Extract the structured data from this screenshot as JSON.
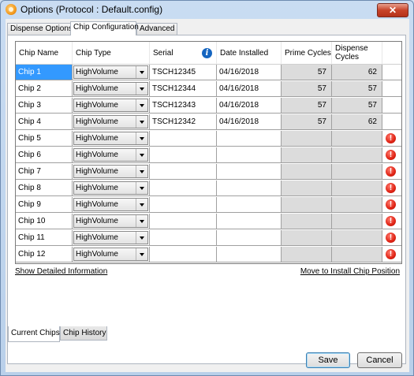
{
  "window": {
    "title": "Options (Protocol : Default.config)",
    "close_glyph": "✕",
    "app_icon": "options-app-icon"
  },
  "tabs": [
    {
      "label": "Dispense Options",
      "active": false
    },
    {
      "label": "Chip Configuration",
      "active": true
    },
    {
      "label": "Advanced",
      "active": false
    }
  ],
  "grid": {
    "headers": {
      "chip_name": "Chip Name",
      "chip_type": "Chip Type",
      "serial": "Serial",
      "date_installed": "Date Installed",
      "prime_cycles": "Prime Cycles",
      "dispense_cycles": "Dispense Cycles"
    },
    "rows": [
      {
        "name": "Chip 1",
        "type": "HighVolume",
        "serial": "TSCH12345",
        "date": "04/16/2018",
        "prime": "57",
        "dispense": "62",
        "warning": false,
        "selected": true
      },
      {
        "name": "Chip 2",
        "type": "HighVolume",
        "serial": "TSCH12344",
        "date": "04/16/2018",
        "prime": "57",
        "dispense": "57",
        "warning": false,
        "selected": false
      },
      {
        "name": "Chip 3",
        "type": "HighVolume",
        "serial": "TSCH12343",
        "date": "04/16/2018",
        "prime": "57",
        "dispense": "57",
        "warning": false,
        "selected": false
      },
      {
        "name": "Chip 4",
        "type": "HighVolume",
        "serial": "TSCH12342",
        "date": "04/16/2018",
        "prime": "57",
        "dispense": "62",
        "warning": false,
        "selected": false
      },
      {
        "name": "Chip 5",
        "type": "HighVolume",
        "serial": "",
        "date": "",
        "prime": "",
        "dispense": "",
        "warning": true,
        "selected": false
      },
      {
        "name": "Chip 6",
        "type": "HighVolume",
        "serial": "",
        "date": "",
        "prime": "",
        "dispense": "",
        "warning": true,
        "selected": false
      },
      {
        "name": "Chip 7",
        "type": "HighVolume",
        "serial": "",
        "date": "",
        "prime": "",
        "dispense": "",
        "warning": true,
        "selected": false
      },
      {
        "name": "Chip 8",
        "type": "HighVolume",
        "serial": "",
        "date": "",
        "prime": "",
        "dispense": "",
        "warning": true,
        "selected": false
      },
      {
        "name": "Chip 9",
        "type": "HighVolume",
        "serial": "",
        "date": "",
        "prime": "",
        "dispense": "",
        "warning": true,
        "selected": false
      },
      {
        "name": "Chip 10",
        "type": "HighVolume",
        "serial": "",
        "date": "",
        "prime": "",
        "dispense": "",
        "warning": true,
        "selected": false
      },
      {
        "name": "Chip 11",
        "type": "HighVolume",
        "serial": "",
        "date": "",
        "prime": "",
        "dispense": "",
        "warning": true,
        "selected": false
      },
      {
        "name": "Chip 12",
        "type": "HighVolume",
        "serial": "",
        "date": "",
        "prime": "",
        "dispense": "",
        "warning": true,
        "selected": false
      }
    ],
    "info_glyph": "i",
    "warning_glyph": "!"
  },
  "links": {
    "show_detailed": "Show Detailed Information",
    "move_to_install": "Move to Install Chip Position"
  },
  "bottom_tabs": [
    {
      "label": "Current Chips",
      "active": true
    },
    {
      "label": "Chip History",
      "active": false
    }
  ],
  "buttons": {
    "save": "Save",
    "cancel": "Cancel"
  },
  "colors": {
    "selection": "#3399ff",
    "warning": "#e02314",
    "info": "#1565c0"
  }
}
